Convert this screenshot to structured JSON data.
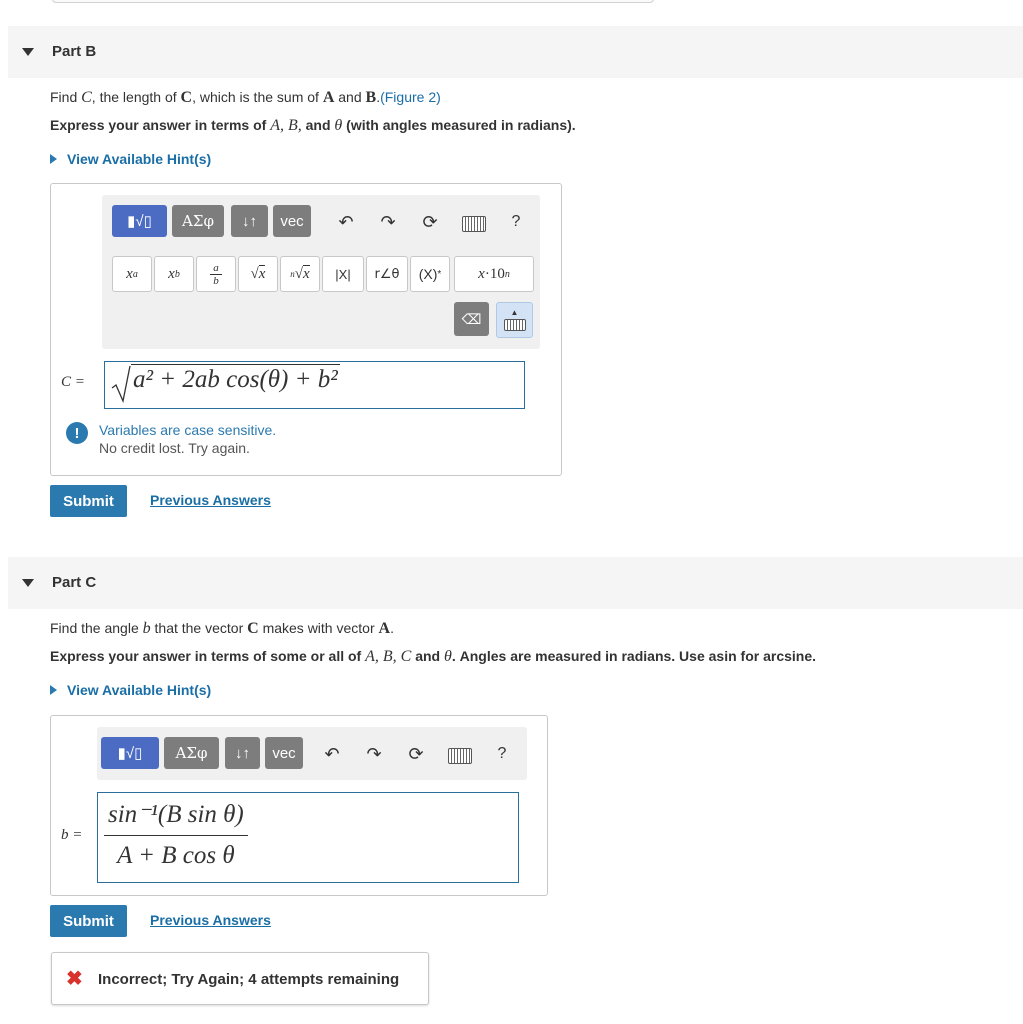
{
  "partB": {
    "title": "Part B",
    "question_prefix": "Find ",
    "question_var_C": "C",
    "question_mid": ", the length of ",
    "question_vec_C": "C",
    "question_mid2": ", which is the sum of ",
    "question_vec_A": "A",
    "question_and": " and ",
    "question_vec_B": "B",
    "question_dot": ".",
    "figure_link": "(Figure 2)",
    "instruction_prefix": "Express your answer in terms of ",
    "instruction_vars": "A, B,",
    "instruction_and": " and ",
    "instruction_theta": "θ",
    "instruction_suffix": " (with angles measured in radians).",
    "hint": "View Available Hint(s)",
    "toolbar": {
      "templates": "▮√▯",
      "greek": "ΑΣφ",
      "arrows": "↓↑",
      "vec": "vec",
      "help": "?"
    },
    "symbols": {
      "power": "xᵃ",
      "subscript": "x_b",
      "fraction": "a/b",
      "sqrt": "√x",
      "nroot": "ⁿ√x",
      "abs": "|X|",
      "angle": "r∠θ",
      "conj": "(X)*",
      "sci": "x·10ⁿ"
    },
    "answer_label": "C =",
    "answer_expr": "a² + 2ab cos(θ) + b²",
    "feedback_title": "Variables are case sensitive.",
    "feedback_sub": "No credit lost. Try again.",
    "submit": "Submit",
    "previous": "Previous Answers"
  },
  "partC": {
    "title": "Part C",
    "question_prefix": "Find the angle ",
    "question_var_b": "b",
    "question_mid": " that the vector ",
    "question_vec_C": "C",
    "question_mid2": " makes with vector ",
    "question_vec_A": "A",
    "question_dot": ".",
    "instruction_prefix": "Express your answer in terms of some or all of ",
    "instruction_vars": "A, B, C",
    "instruction_and": " and ",
    "instruction_theta": "θ",
    "instruction_suffix": ". Angles are measured in radians. Use asin for arcsine.",
    "hint": "View Available Hint(s)",
    "toolbar": {
      "templates": "▮√▯",
      "greek": "ΑΣφ",
      "arrows": "↓↑",
      "vec": "vec",
      "help": "?"
    },
    "answer_label": "b =",
    "answer_numerator": "sin⁻¹(B sin θ)",
    "answer_denominator": "A + B cos θ",
    "submit": "Submit",
    "previous": "Previous Answers",
    "incorrect": "Incorrect; Try Again; 4 attempts remaining"
  },
  "colors": {
    "accent": "#2a7ab0",
    "link": "#1a6ea6",
    "error": "#d9312b"
  }
}
